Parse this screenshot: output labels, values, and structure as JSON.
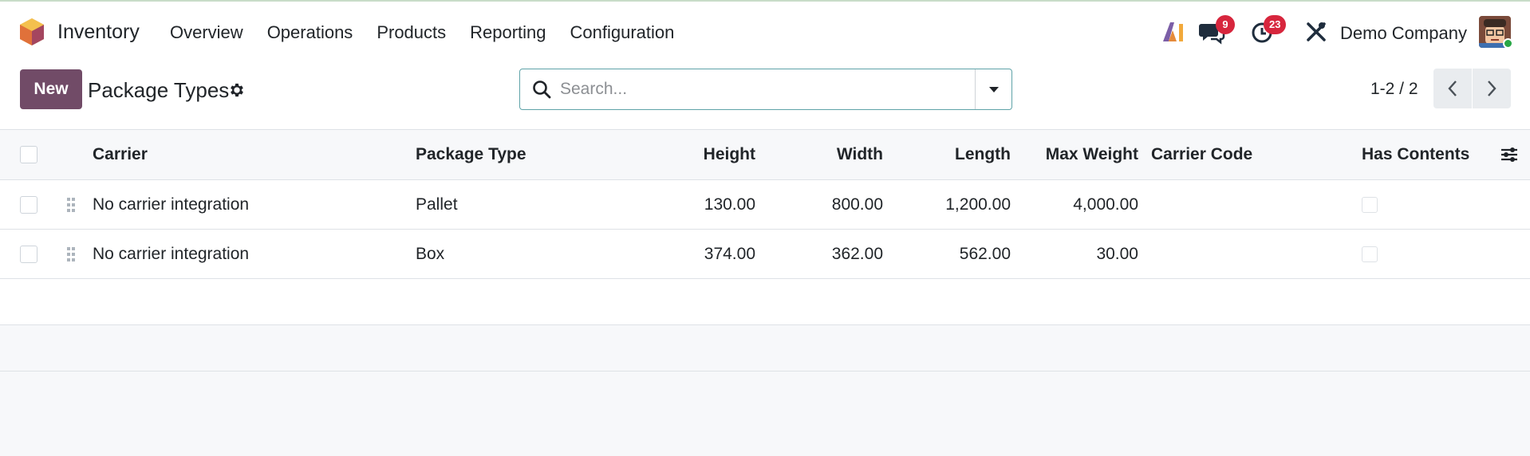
{
  "app": {
    "name": "Inventory",
    "menu": [
      "Overview",
      "Operations",
      "Products",
      "Reporting",
      "Configuration"
    ]
  },
  "systray": {
    "messages_count": "9",
    "activities_count": "23",
    "company": "Demo Company"
  },
  "control": {
    "new_label": "New",
    "page_title": "Package Types",
    "search_placeholder": "Search...",
    "pager": "1-2 / 2"
  },
  "table": {
    "columns": {
      "carrier": "Carrier",
      "package_type": "Package Type",
      "height": "Height",
      "width": "Width",
      "length": "Length",
      "max_weight": "Max Weight",
      "carrier_code": "Carrier Code",
      "has_contents": "Has Contents"
    },
    "rows": [
      {
        "carrier": "No carrier integration",
        "package_type": "Pallet",
        "height": "130.00",
        "width": "800.00",
        "length": "1,200.00",
        "max_weight": "4,000.00",
        "carrier_code": ""
      },
      {
        "carrier": "No carrier integration",
        "package_type": "Box",
        "height": "374.00",
        "width": "362.00",
        "length": "562.00",
        "max_weight": "30.00",
        "carrier_code": ""
      }
    ]
  },
  "colors": {
    "brand": "#714b67",
    "badge": "#d7263d",
    "search_border": "#5fa3a8"
  }
}
